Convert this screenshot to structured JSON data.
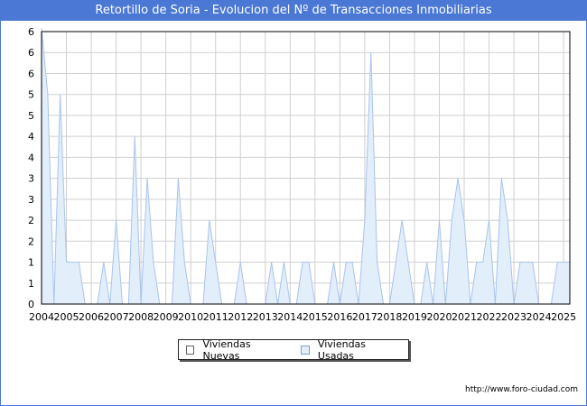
{
  "title": "Retortillo de Soria - Evolucion del Nº de Transacciones Inmobiliarias",
  "footer_url": "http://www.foro-ciudad.com",
  "chart_data": {
    "type": "area",
    "title": "Retortillo de Soria - Evolucion del Nº de Transacciones Inmobiliarias",
    "xlabel": "",
    "ylabel": "",
    "x_tick_labels": [
      "2004",
      "2005",
      "2006",
      "2007",
      "2008",
      "2009",
      "2010",
      "2011",
      "2012",
      "2013",
      "2014",
      "2015",
      "2016",
      "2017",
      "2018",
      "2019",
      "2020",
      "2021",
      "2022",
      "2023",
      "2024",
      "2025"
    ],
    "y_tick_labels": [
      "0",
      "1",
      "1",
      "2",
      "2",
      "3",
      "3",
      "4",
      "4",
      "5",
      "5",
      "6",
      "6",
      "6"
    ],
    "x_range": [
      2004,
      2025.25
    ],
    "y_range": [
      0,
      6.5
    ],
    "grid": true,
    "legend_position": "bottom-center",
    "series": [
      {
        "name": "Viviendas Nuevas",
        "color": "#ffffff",
        "values": []
      },
      {
        "name": "Viviendas Usadas",
        "color": "#a8c4ec",
        "fill": "#e2eefa",
        "points": [
          [
            2004.0,
            7
          ],
          [
            2004.25,
            5
          ],
          [
            2004.5,
            0
          ],
          [
            2004.75,
            5
          ],
          [
            2005.0,
            1
          ],
          [
            2005.25,
            1
          ],
          [
            2005.5,
            1
          ],
          [
            2005.75,
            0
          ],
          [
            2006.0,
            0
          ],
          [
            2006.25,
            0
          ],
          [
            2006.5,
            1
          ],
          [
            2006.75,
            0
          ],
          [
            2007.0,
            2
          ],
          [
            2007.25,
            0
          ],
          [
            2007.5,
            0
          ],
          [
            2007.75,
            4
          ],
          [
            2008.0,
            0
          ],
          [
            2008.25,
            3
          ],
          [
            2008.5,
            1
          ],
          [
            2008.75,
            0
          ],
          [
            2009.0,
            0
          ],
          [
            2009.25,
            0
          ],
          [
            2009.5,
            3
          ],
          [
            2009.75,
            1
          ],
          [
            2010.0,
            0
          ],
          [
            2010.25,
            0
          ],
          [
            2010.5,
            0
          ],
          [
            2010.75,
            2
          ],
          [
            2011.0,
            1
          ],
          [
            2011.25,
            0
          ],
          [
            2011.5,
            0
          ],
          [
            2011.75,
            0
          ],
          [
            2012.0,
            1
          ],
          [
            2012.25,
            0
          ],
          [
            2012.5,
            0
          ],
          [
            2012.75,
            0
          ],
          [
            2013.0,
            0
          ],
          [
            2013.25,
            1
          ],
          [
            2013.5,
            0
          ],
          [
            2013.75,
            1
          ],
          [
            2014.0,
            0
          ],
          [
            2014.25,
            0
          ],
          [
            2014.5,
            1
          ],
          [
            2014.75,
            1
          ],
          [
            2015.0,
            0
          ],
          [
            2015.25,
            0
          ],
          [
            2015.5,
            0
          ],
          [
            2015.75,
            1
          ],
          [
            2016.0,
            0
          ],
          [
            2016.25,
            1
          ],
          [
            2016.5,
            1
          ],
          [
            2016.75,
            0
          ],
          [
            2017.0,
            2
          ],
          [
            2017.25,
            6
          ],
          [
            2017.5,
            1
          ],
          [
            2017.75,
            0
          ],
          [
            2018.0,
            0
          ],
          [
            2018.25,
            1
          ],
          [
            2018.5,
            2
          ],
          [
            2018.75,
            1
          ],
          [
            2019.0,
            0
          ],
          [
            2019.25,
            0
          ],
          [
            2019.5,
            1
          ],
          [
            2019.75,
            0
          ],
          [
            2020.0,
            2
          ],
          [
            2020.25,
            0
          ],
          [
            2020.5,
            2
          ],
          [
            2020.75,
            3
          ],
          [
            2021.0,
            2
          ],
          [
            2021.25,
            0
          ],
          [
            2021.5,
            1
          ],
          [
            2021.75,
            1
          ],
          [
            2022.0,
            2
          ],
          [
            2022.25,
            0
          ],
          [
            2022.5,
            3
          ],
          [
            2022.75,
            2
          ],
          [
            2023.0,
            0
          ],
          [
            2023.25,
            1
          ],
          [
            2023.5,
            1
          ],
          [
            2023.75,
            1
          ],
          [
            2024.0,
            0
          ],
          [
            2024.25,
            0
          ],
          [
            2024.5,
            0
          ],
          [
            2024.75,
            1
          ],
          [
            2025.0,
            1
          ],
          [
            2025.25,
            1
          ]
        ]
      }
    ]
  }
}
